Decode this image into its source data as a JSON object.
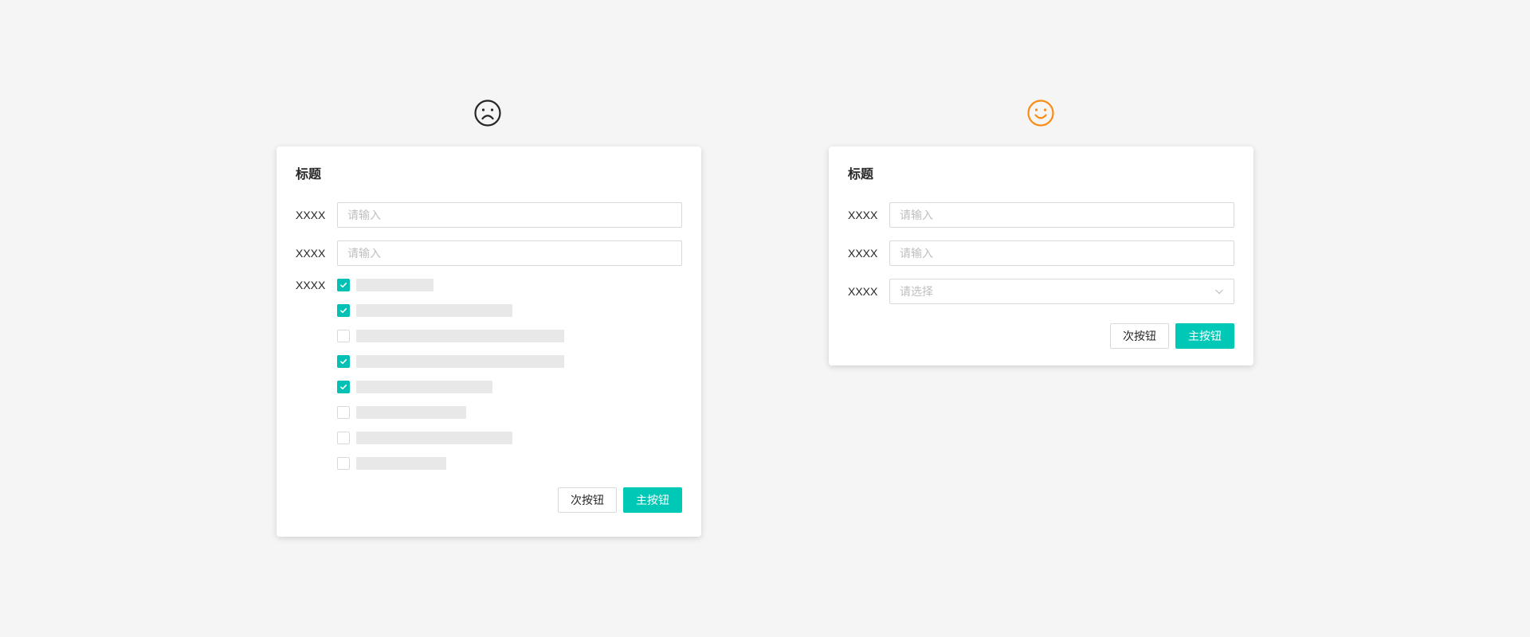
{
  "colors": {
    "primary": "#00c8b7",
    "bad_face": "#262626",
    "good_face": "#fa8c16",
    "placeholder": "#bfbfbf",
    "bar": "#e8e8e8"
  },
  "bad_example": {
    "face_icon": "frown-face-icon",
    "title": "标题",
    "fields": [
      {
        "label": "XXXX",
        "placeholder": "请输入"
      },
      {
        "label": "XXXX",
        "placeholder": "请输入"
      }
    ],
    "checkbox_group": {
      "label": "XXXX",
      "items": [
        {
          "checked": true
        },
        {
          "checked": true
        },
        {
          "checked": false
        },
        {
          "checked": true
        },
        {
          "checked": true
        },
        {
          "checked": false
        },
        {
          "checked": false
        },
        {
          "checked": false
        }
      ]
    },
    "secondary_button": "次按钮",
    "primary_button": "主按钮"
  },
  "good_example": {
    "face_icon": "smile-face-icon",
    "title": "标题",
    "fields": [
      {
        "label": "XXXX",
        "placeholder": "请输入"
      },
      {
        "label": "XXXX",
        "placeholder": "请输入"
      }
    ],
    "select": {
      "label": "XXXX",
      "placeholder": "请选择"
    },
    "secondary_button": "次按钮",
    "primary_button": "主按钮"
  }
}
